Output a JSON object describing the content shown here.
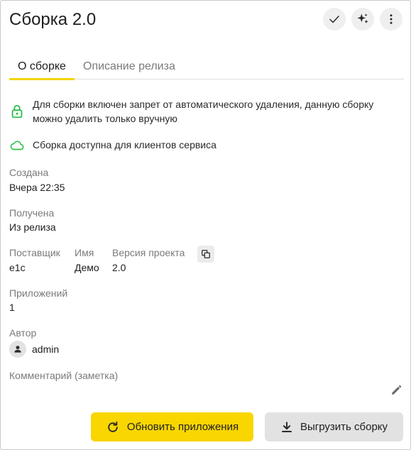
{
  "header": {
    "title": "Сборка 2.0"
  },
  "tabs": [
    {
      "label": "О сборке",
      "active": true
    },
    {
      "label": "Описание релиза",
      "active": false
    }
  ],
  "notices": {
    "lock_text": "Для сборки включен запрет от автоматического удаления, данную сборку можно удалить только вручную",
    "cloud_text": "Сборка доступна для клиентов сервиса"
  },
  "details": {
    "created_label": "Создана",
    "created_value": "Вчера 22:35",
    "received_label": "Получена",
    "received_value": "Из релиза",
    "vendor_label": "Поставщик",
    "vendor_value": "e1c",
    "name_label": "Имя",
    "name_value": "Демо",
    "version_label": "Версия проекта",
    "version_value": "2.0",
    "apps_label": "Приложений",
    "apps_value": "1",
    "author_label": "Автор",
    "author_value": "admin",
    "comment_label": "Комментарий (заметка)"
  },
  "actions": {
    "update_label": "Обновить приложения",
    "export_label": "Выгрузить сборку"
  },
  "icons": {
    "check": "check-icon",
    "sparkle": "sparkle-icon",
    "menu": "more-vert-icon",
    "lock": "lock-icon",
    "cloud": "cloud-icon",
    "copy": "copy-icon",
    "person": "person-icon",
    "edit": "pencil-icon",
    "refresh": "refresh-icon",
    "download": "download-icon"
  },
  "colors": {
    "accent_yellow": "#f9d600",
    "tab_underline": "#f5d400",
    "status_green": "#2fbf4f",
    "secondary_button": "#e2e2e2"
  }
}
